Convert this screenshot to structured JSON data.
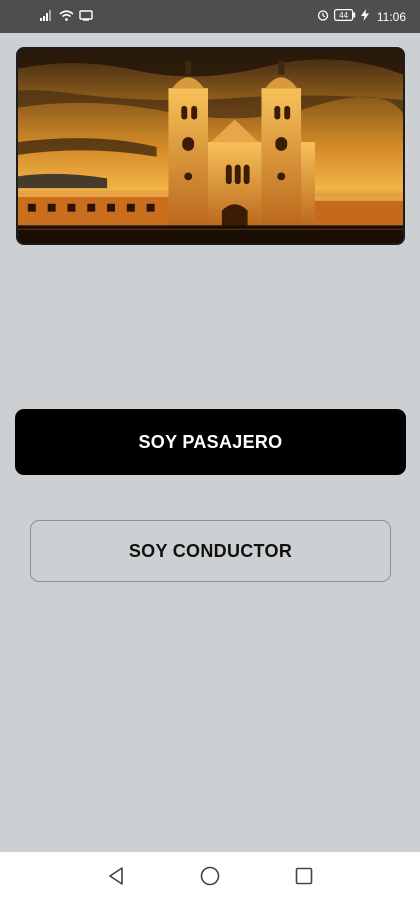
{
  "status_bar": {
    "time": "11:06",
    "battery_level": "44",
    "icons_left": [
      "signal-icon",
      "wifi-icon",
      "cast-icon"
    ],
    "icons_right": [
      "alarm-icon",
      "battery-icon",
      "charging-icon"
    ]
  },
  "hero": {
    "image": "cathedral-night-photo"
  },
  "buttons": {
    "passenger": "SOY PASAJERO",
    "driver": "SOY CONDUCTOR"
  },
  "colors": {
    "background": "#cdd0d2",
    "primary_button": "#000000",
    "status_bar": "#4e4e4e"
  },
  "nav_bar": {
    "icons": [
      "back-icon",
      "home-icon",
      "recents-icon"
    ]
  }
}
